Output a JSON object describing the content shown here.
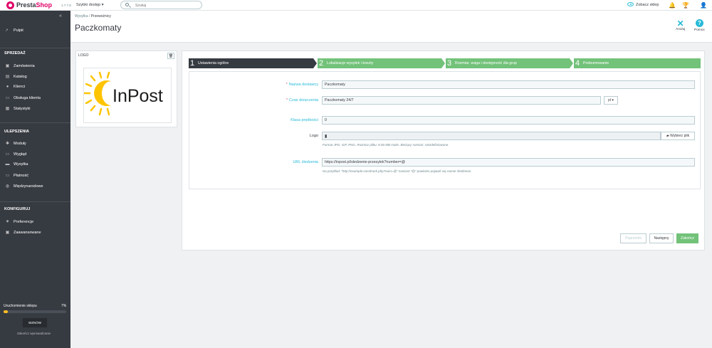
{
  "topbar": {
    "brand_presta": "Presta",
    "brand_shop": "Shop",
    "version": "1.7.7.8",
    "quick_access": "Szybki dostęp ▾",
    "search_placeholder": "Szukaj",
    "view_shop": "Zobacz sklep"
  },
  "sidebar": {
    "dashboard": "Pulpit",
    "sections": [
      {
        "title": "SPRZEDAŻ",
        "items": [
          "Zamówienia",
          "Katalog",
          "Klienci",
          "Obsługa klienta",
          "Statystyki"
        ]
      },
      {
        "title": "ULEPSZENIA",
        "items": [
          "Moduły",
          "Wygląd",
          "Wysyłka",
          "Płatność",
          "Międzynarodowe"
        ]
      },
      {
        "title": "KONFIGURUJ",
        "items": [
          "Preferencje",
          "Zaawansowane"
        ]
      }
    ],
    "launch_label": "Uruchomienie sklepu",
    "launch_percent": "7%",
    "launch_progress": 0.07,
    "resume": "WZNÓW",
    "finish_intro": "Zakończ wprowadzanie"
  },
  "header": {
    "breadcrumb_parent": "Wysyłka",
    "breadcrumb_sep": "/",
    "breadcrumb_current": "Przewoźnicy",
    "title": "Paczkomaty",
    "cancel": "Anuluj",
    "help": "Pomoc"
  },
  "logo_panel": {
    "label": "LOGO",
    "image_text": "InPost"
  },
  "steps": [
    {
      "num": "1",
      "label": "Ustawienia ogólne"
    },
    {
      "num": "2",
      "label": "Lokalizacje wysyłek i koszty"
    },
    {
      "num": "3",
      "label": "Rozmiar, waga i dostępność dla grup"
    },
    {
      "num": "4",
      "label": "Podsumowanie"
    }
  ],
  "form": {
    "carrier_name_label": "Nazwa dostawcy",
    "carrier_name_value": "Paczkomaty",
    "transit_label": "Czas doręczenia",
    "transit_value": "Paczkomaty 24/7",
    "lang": "pl ▾",
    "speed_label": "Klasa prędkości",
    "speed_value": "0",
    "logo_label": "Logo",
    "choose_file": "Wybierz plik",
    "logo_hint": "Format JPG, GIF, PNG. Rozmiar pliku: 8.00 MB maks. Bieżący rozmiar: niezdefiniowane.",
    "tracking_label": "URL śledzenia",
    "tracking_value": "https://inpost.pl/sledzenie-przesylek?number=@",
    "tracking_hint": "Na przykład: \"http://example.com/track.php?num=@\" zamiast \"@\" powinien pojawić się numer śledzenia."
  },
  "buttons": {
    "prev": "Poprzedni",
    "next": "Następny",
    "finish": "Zakończ"
  },
  "colors": {
    "accent": "#25b9d7",
    "brand": "#df0067",
    "step_done": "#72c279",
    "step_active": "#363a41",
    "sidebar": "#363a41"
  }
}
